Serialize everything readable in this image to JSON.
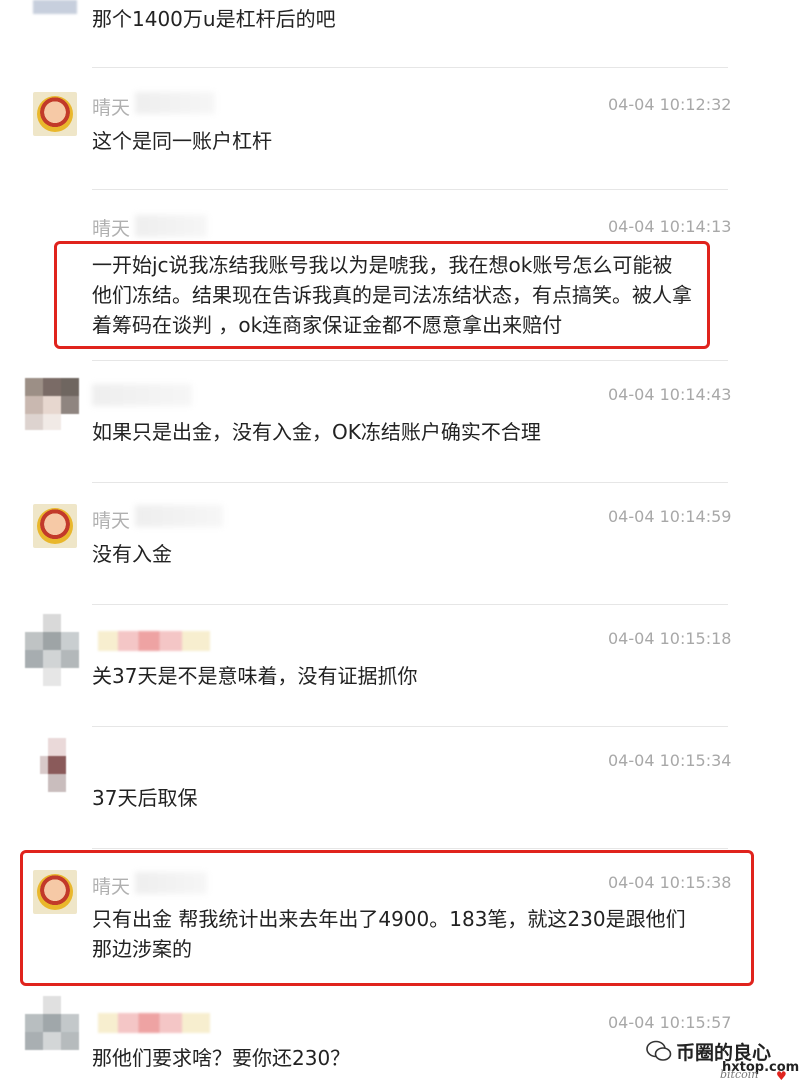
{
  "messages": [
    {
      "name": "",
      "time": "",
      "text": "那个1400万u是杠杆后的吧"
    },
    {
      "name": "晴天",
      "time": "04-04 10:12:32",
      "text": "这个是同一账户杠杆"
    },
    {
      "name": "晴天",
      "time": "04-04 10:14:13",
      "text": "一开始jc说我冻结我账号我以为是唬我，我在想ok账号怎么可能被他们冻结。结果现在告诉我真的是司法冻结状态，有点搞笑。被人拿着筹码在谈判 ，ok连商家保证金都不愿意拿出来赔付"
    },
    {
      "name": "",
      "time": "04-04 10:14:43",
      "text": "如果只是出金，没有入金，OK冻结账户确实不合理"
    },
    {
      "name": "晴天",
      "time": "04-04 10:14:59",
      "text": "没有入金"
    },
    {
      "name": "",
      "time": "04-04 10:15:18",
      "text": "关37天是不是意味着，没有证据抓你"
    },
    {
      "name": "",
      "time": "04-04 10:15:34",
      "text": "37天后取保"
    },
    {
      "name": "晴天",
      "time": "04-04 10:15:38",
      "text": "只有出金 帮我统计出来去年出了4900。183笔，就这230是跟他们那边涉案的"
    },
    {
      "name": "",
      "time": "04-04 10:15:57",
      "text": "那他们要求啥？要你还230？"
    }
  ],
  "watermark": {
    "brand": "币圈的良心",
    "site": "hxtop.com",
    "sub": "bitcoin"
  },
  "colors": {
    "highlight": "#e0231d",
    "time": "#a8a8a8",
    "name": "#b0b0b0"
  }
}
